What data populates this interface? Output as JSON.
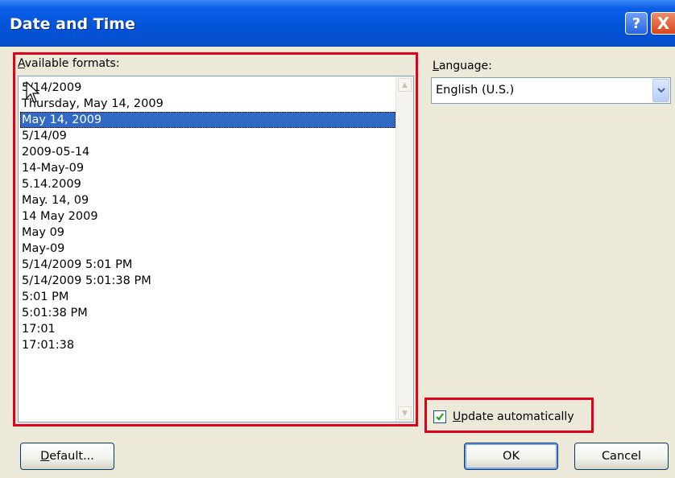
{
  "window": {
    "title": "Date and Time",
    "help_label": "?",
    "close_label": "X"
  },
  "formats": {
    "label_mnemonic": "A",
    "label_rest": "vailable formats:",
    "items": [
      "5/14/2009",
      "Thursday, May 14, 2009",
      "May 14, 2009",
      "5/14/09",
      "2009-05-14",
      "14-May-09",
      "5.14.2009",
      "May. 14, 09",
      "14 May 2009",
      "May 09",
      "May-09",
      "5/14/2009 5:01 PM",
      "5/14/2009 5:01:38 PM",
      "5:01 PM",
      "5:01:38 PM",
      "17:01",
      "17:01:38"
    ],
    "selected_index": 2
  },
  "language": {
    "label_mnemonic": "L",
    "label_rest": "anguage:",
    "value": "English (U.S.)"
  },
  "update_auto": {
    "label_mnemonic": "U",
    "label_rest": "pdate automatically",
    "checked": true
  },
  "buttons": {
    "default_mnemonic": "D",
    "default_rest": "efault...",
    "ok": "OK",
    "cancel": "Cancel"
  },
  "colors": {
    "highlight_outline": "#e0001b",
    "selection": "#316ac5",
    "titlebar": "#0454d8"
  }
}
